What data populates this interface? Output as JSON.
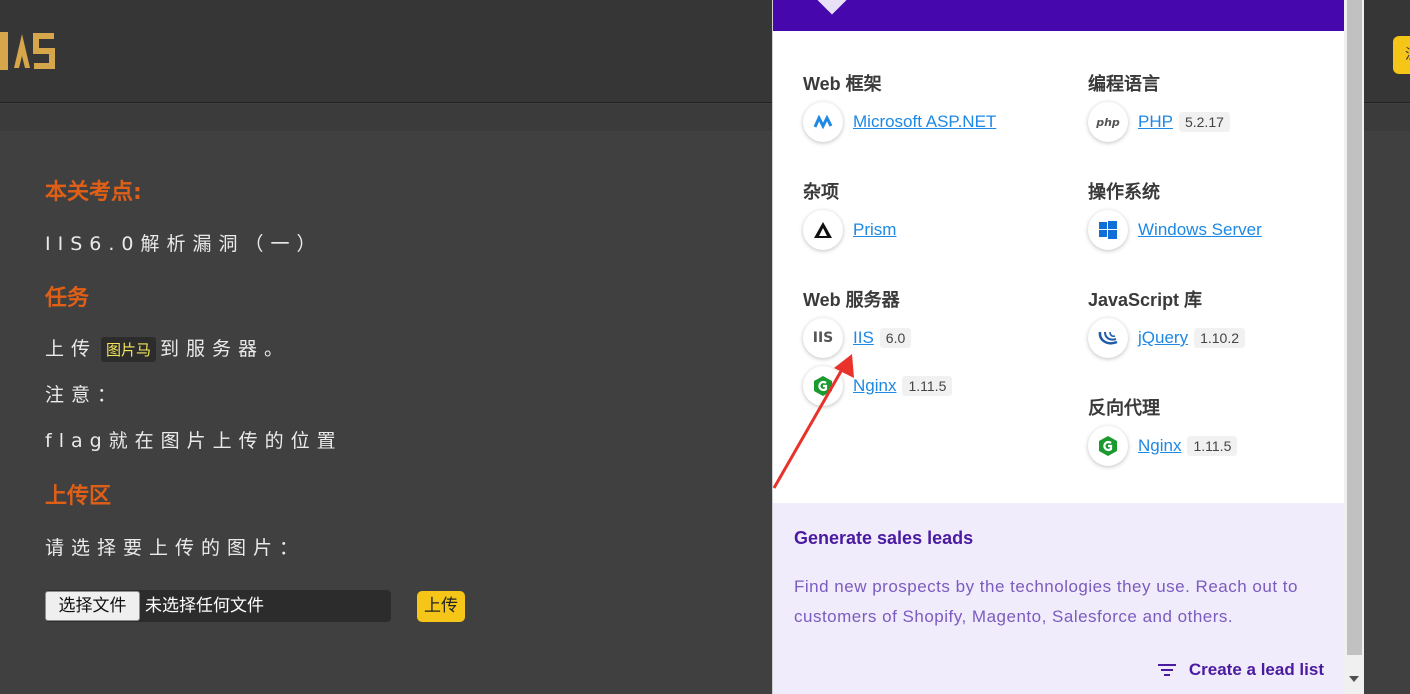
{
  "page": {
    "logo_text": "IIS",
    "topbar_button": "注",
    "sections": {
      "exam_title": "本关考点:",
      "exam_text": "IIS6.0解析漏洞（一）",
      "task_title": "任务",
      "task_prefix": "上传",
      "task_code": "图片马",
      "task_suffix": "到服务器。",
      "note_label": "注意：",
      "note_text": "flag就在图片上传的位置",
      "upload_title": "上传区",
      "upload_prompt": "请选择要上传的图片："
    },
    "file_input": {
      "button_label": "选择文件",
      "status": "未选择任何文件"
    },
    "upload_button": "上传"
  },
  "popup": {
    "categories": {
      "web_framework": {
        "title": "Web 框架",
        "items": [
          {
            "name": "Microsoft ASP.NET",
            "version": "",
            "icon": "aspnet-icon"
          }
        ]
      },
      "programming_language": {
        "title": "编程语言",
        "items": [
          {
            "name": "PHP",
            "version": "5.2.17",
            "icon": "php-icon"
          }
        ]
      },
      "misc": {
        "title": "杂项",
        "items": [
          {
            "name": "Prism",
            "version": "",
            "icon": "prism-icon"
          }
        ]
      },
      "os": {
        "title": "操作系统",
        "items": [
          {
            "name": "Windows Server",
            "version": "",
            "icon": "windows-icon"
          }
        ]
      },
      "web_server": {
        "title": "Web 服务器",
        "items": [
          {
            "name": "IIS",
            "version": "6.0",
            "icon": "iis-icon"
          },
          {
            "name": "Nginx",
            "version": "1.11.5",
            "icon": "nginx-icon"
          }
        ]
      },
      "js_library": {
        "title": "JavaScript 库",
        "items": [
          {
            "name": "jQuery",
            "version": "1.10.2",
            "icon": "jquery-icon"
          }
        ]
      },
      "reverse_proxy": {
        "title": "反向代理",
        "items": [
          {
            "name": "Nginx",
            "version": "1.11.5",
            "icon": "nginx-icon"
          }
        ]
      }
    },
    "promo": {
      "title": "Generate sales leads",
      "text": "Find new prospects by the technologies they use. Reach out to customers of Shopify, Magento, Salesforce and others.",
      "cta": "Create a lead list"
    }
  },
  "colors": {
    "accent_purple": "#4608ad",
    "link_blue": "#1e88e5",
    "heading_orange": "#e05f16",
    "button_yellow": "#f5c518"
  }
}
